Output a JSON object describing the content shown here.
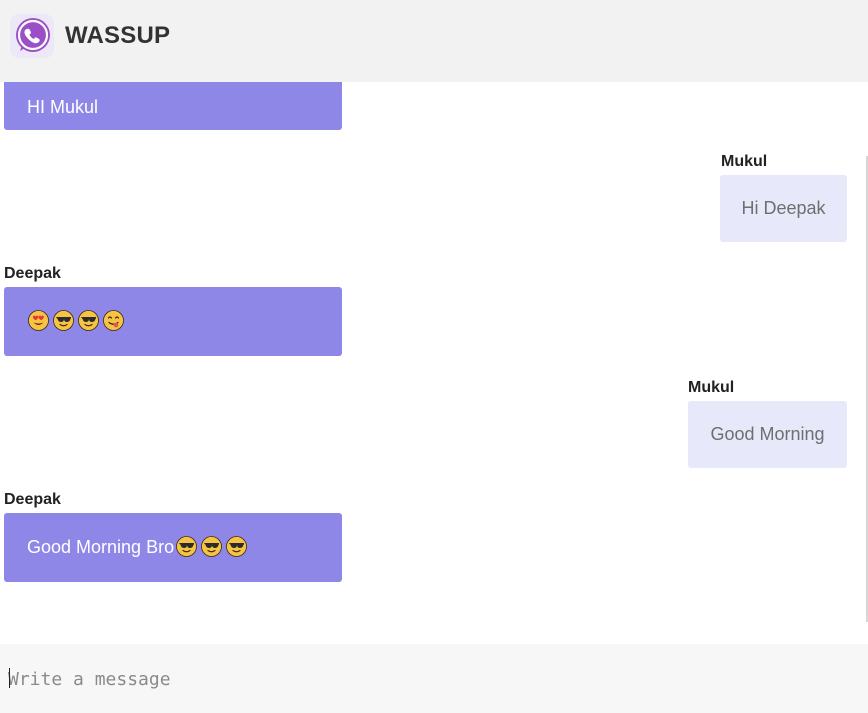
{
  "app": {
    "title": "WASSUP"
  },
  "messages": [
    {
      "sender": "",
      "text": "HI Mukul",
      "direction": "in",
      "emojis": []
    },
    {
      "sender": "Mukul",
      "text": "Hi Deepak",
      "direction": "out",
      "emojis": []
    },
    {
      "sender": "Deepak",
      "text": "",
      "direction": "in",
      "emojis": [
        "heart-eyes",
        "sunglasses",
        "sunglasses",
        "yum"
      ]
    },
    {
      "sender": "Mukul",
      "text": "Good Morning",
      "direction": "out",
      "emojis": []
    },
    {
      "sender": "Deepak",
      "text": "Good Morning Bro",
      "direction": "in",
      "emojis": [
        "sunglasses",
        "sunglasses",
        "sunglasses"
      ]
    }
  ],
  "composer": {
    "placeholder": "Write a message",
    "value": ""
  },
  "colors": {
    "incoming_bubble": "#8e87e8",
    "outgoing_bubble": "#e8e8fb",
    "logo": "#9b4fc7"
  }
}
